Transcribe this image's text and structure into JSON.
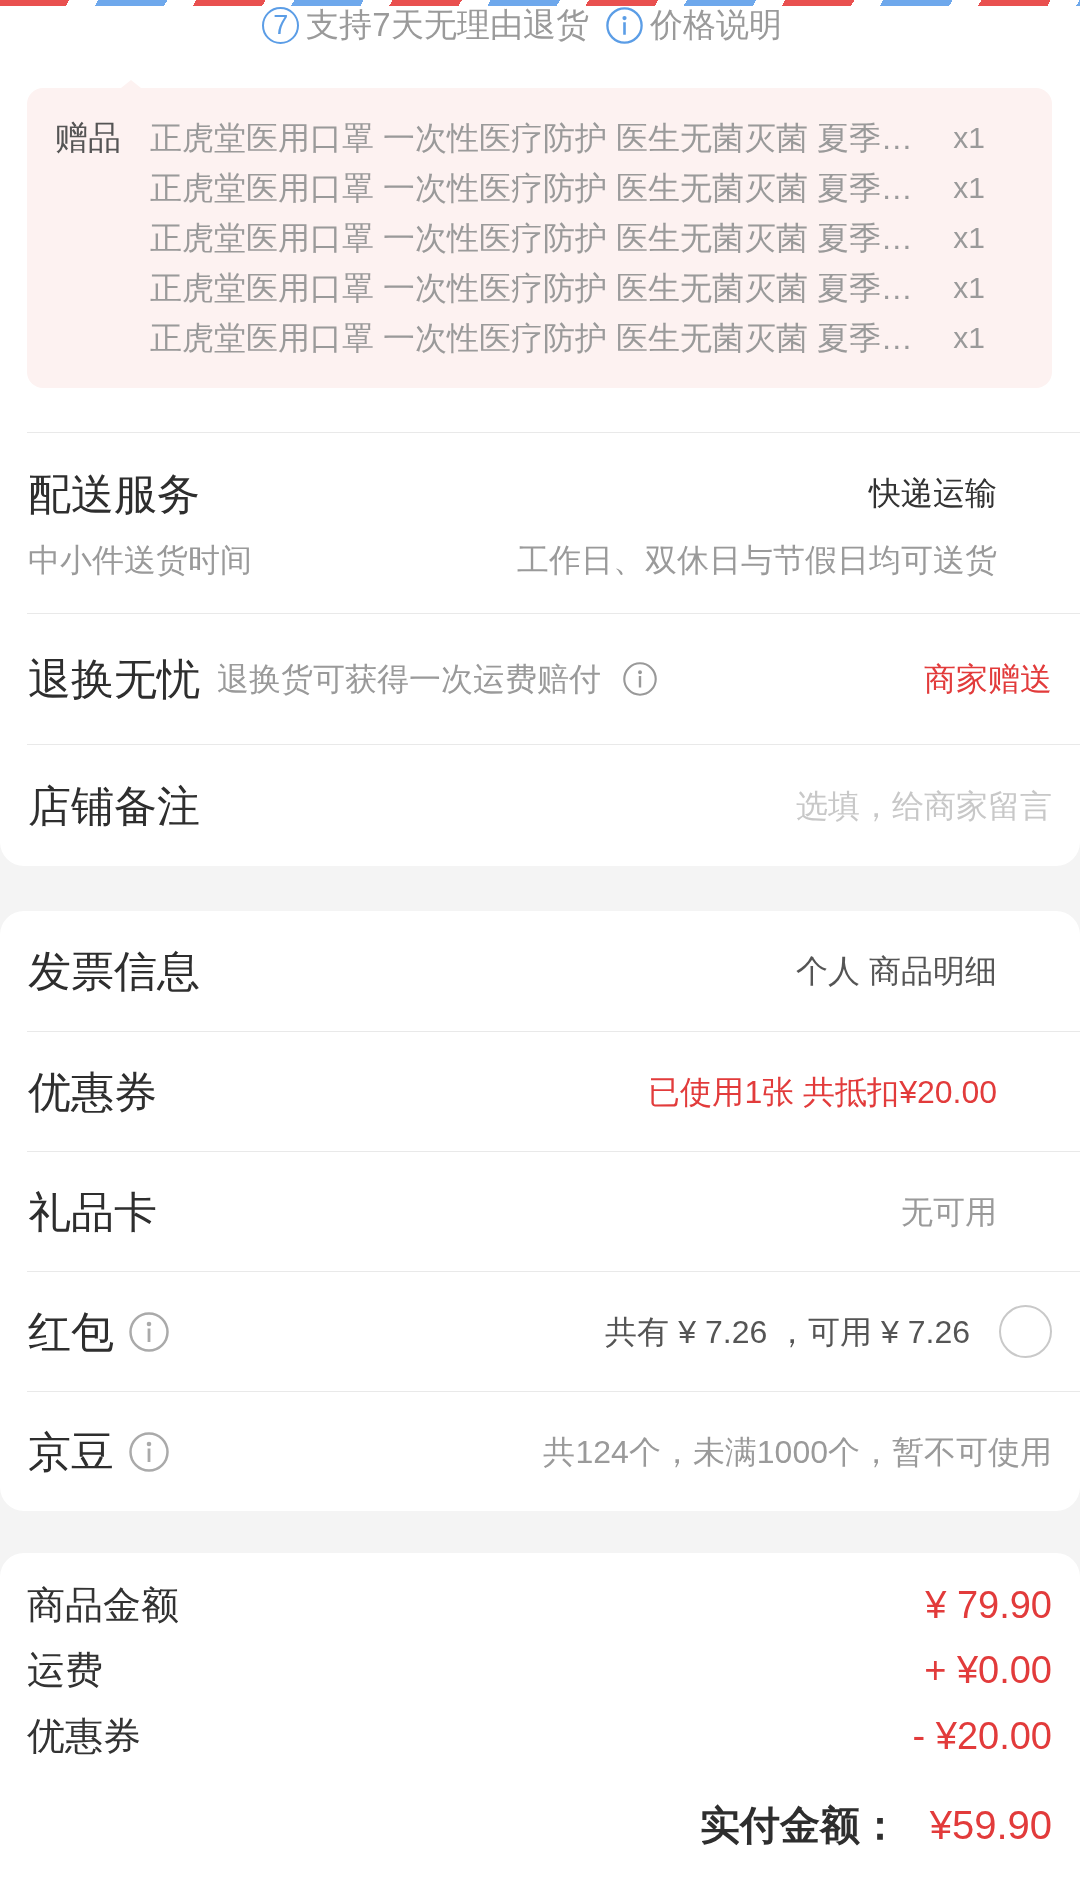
{
  "header": {
    "policies": [
      {
        "kind": "badge",
        "badge": "7",
        "label": "支持7天无理由退货"
      },
      {
        "kind": "info",
        "label": "价格说明"
      }
    ]
  },
  "gifts": {
    "label": "赠品",
    "items": [
      {
        "name": "正虎堂医用口罩 一次性医疗防护 医生无菌灭菌 夏季…",
        "qty": "x1"
      },
      {
        "name": "正虎堂医用口罩 一次性医疗防护 医生无菌灭菌 夏季…",
        "qty": "x1"
      },
      {
        "name": "正虎堂医用口罩 一次性医疗防护 医生无菌灭菌 夏季…",
        "qty": "x1"
      },
      {
        "name": "正虎堂医用口罩 一次性医疗防护 医生无菌灭菌 夏季…",
        "qty": "x1"
      },
      {
        "name": "正虎堂医用口罩 一次性医疗防护 医生无菌灭菌 夏季…",
        "qty": "x1"
      }
    ]
  },
  "order_services": [
    {
      "kind": "delivery",
      "title": "配送服务",
      "value": "快递运输",
      "subtitle": "中小件送货时间",
      "subvalue": "工作日、双休日与节假日均可送货"
    },
    {
      "kind": "service",
      "title": "退换无忧",
      "description": "退换货可获得一次运费赔付",
      "value": "商家赠送"
    },
    {
      "kind": "note",
      "title": "店铺备注",
      "placeholder": "选填，给商家留言"
    }
  ],
  "payment_options": [
    {
      "kind": "select",
      "title": "发票信息",
      "value": "个人 商品明细",
      "info": false,
      "highlighted": false,
      "disabled": false
    },
    {
      "kind": "select",
      "title": "优惠券",
      "value": "已使用1张 共抵扣¥20.00",
      "info": false,
      "highlighted": true,
      "disabled": false
    },
    {
      "kind": "select",
      "title": "礼品卡",
      "value": "无可用",
      "info": false,
      "highlighted": false,
      "disabled": true
    },
    {
      "kind": "toggle",
      "title": "红包",
      "value": "共有 ¥ 7.26 ，可用 ¥ 7.26",
      "info": true,
      "highlighted": false,
      "disabled": false,
      "checked": false
    },
    {
      "kind": "plain",
      "title": "京豆",
      "value": "共124个，未满1000个，暂不可使用",
      "info": true,
      "highlighted": false,
      "disabled": true
    }
  ],
  "summary": {
    "lines": [
      {
        "label": "商品金额",
        "amount": "¥ 79.90"
      },
      {
        "label": "运费",
        "amount": "+ ¥0.00"
      },
      {
        "label": "优惠券",
        "amount": "- ¥20.00"
      }
    ],
    "total": {
      "label": "实付金额：",
      "amount": "¥59.90"
    }
  }
}
